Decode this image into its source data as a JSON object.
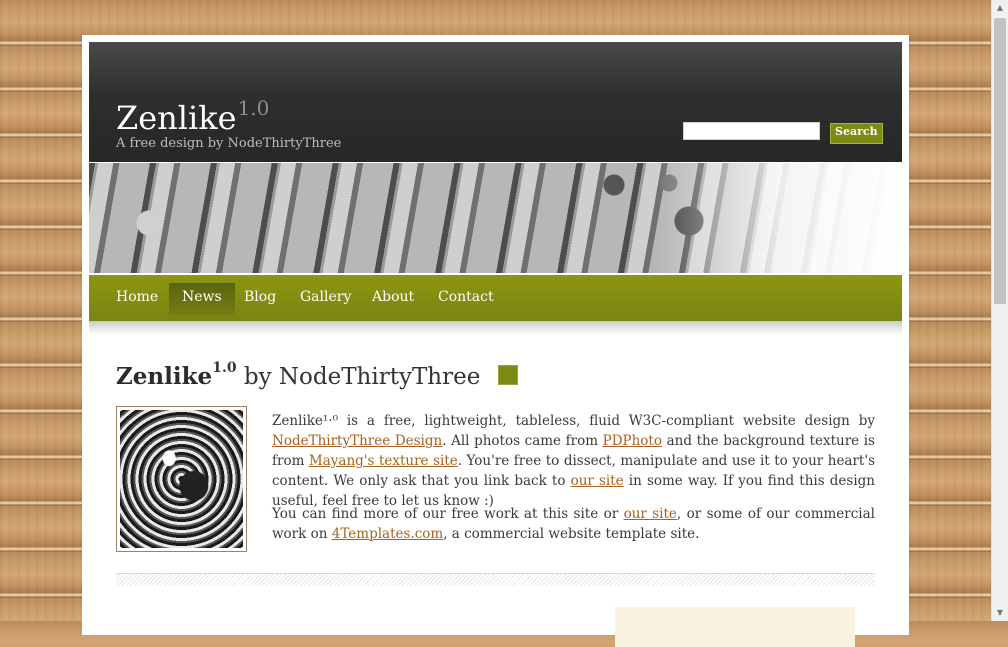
{
  "header": {
    "logo": "Zenlike",
    "logo_version": "1.0",
    "tagline": "A free design by NodeThirtyThree",
    "search_placeholder": "",
    "search_button": "Search"
  },
  "nav": {
    "items": [
      {
        "label": "Home"
      },
      {
        "label": "News"
      },
      {
        "label": "Blog"
      },
      {
        "label": "Gallery"
      },
      {
        "label": "About"
      },
      {
        "label": "Contact"
      }
    ],
    "active": "News"
  },
  "content": {
    "heading_name": "Zenlike",
    "heading_version": "1.0",
    "heading_by": "by NodeThirtyThree",
    "p1": {
      "t1": "Zenlike¹·⁰ is a free, lightweight, tableless, fluid W3C-compliant website design by ",
      "link1": "NodeThirtyThree Design",
      "t2": ". All photos came from ",
      "link2": "PDPhoto",
      "t3": " and the background texture is from ",
      "link3": "Mayang's texture site",
      "t4": ". You're free to dissect, manipulate and use it to your heart's content. We only ask that you link back to ",
      "link4": "our site",
      "t5": " in some way. If you find this design useful, feel free to let us know :)"
    },
    "p2": {
      "t1": "You can find more of our free work at this site or ",
      "link1": "our site",
      "t2": ", or some of our commercial work on ",
      "link2": "4Templates.com",
      "t3": ", a commercial website template site."
    }
  },
  "colors": {
    "accent_green": "#7d8a12",
    "link_brown": "#a5631b",
    "header_dark": "#2e2e2e",
    "sidebar_cream": "#f7f3df"
  },
  "icons": {
    "scroll_up": "▲",
    "scroll_down": "▼"
  }
}
